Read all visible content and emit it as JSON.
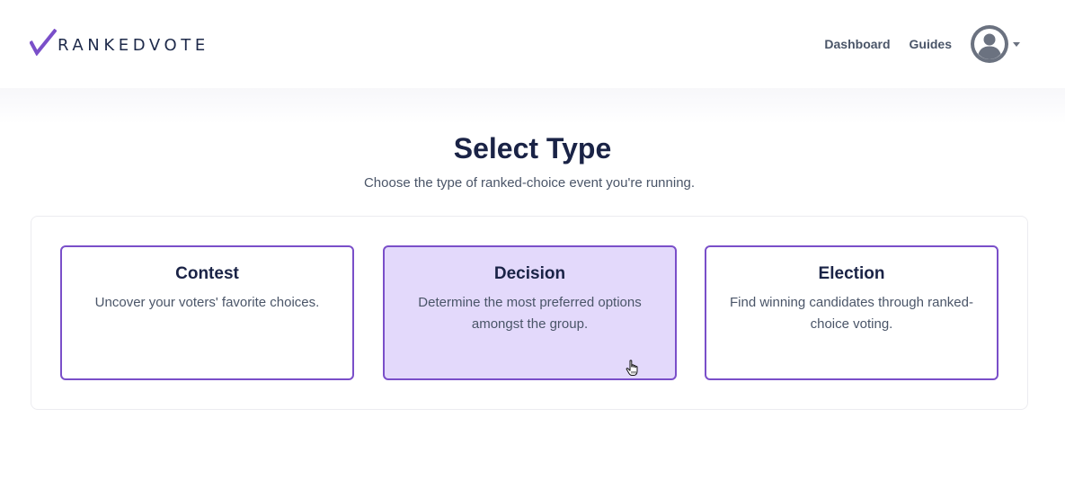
{
  "brand": {
    "name": "RANKEDVOTE",
    "accent": "#7a4fc9"
  },
  "nav": {
    "dashboard": "Dashboard",
    "guides": "Guides",
    "avatar_icon": "user-avatar-icon"
  },
  "main": {
    "title": "Select Type",
    "subtitle": "Choose the type of ranked-choice event you're running.",
    "types": [
      {
        "title": "Contest",
        "description": "Uncover your voters' favorite choices.",
        "selected": false
      },
      {
        "title": "Decision",
        "description": "Determine the most preferred options amongst the group.",
        "selected": true
      },
      {
        "title": "Election",
        "description": "Find winning candidates through ranked-choice voting.",
        "selected": false
      }
    ]
  }
}
